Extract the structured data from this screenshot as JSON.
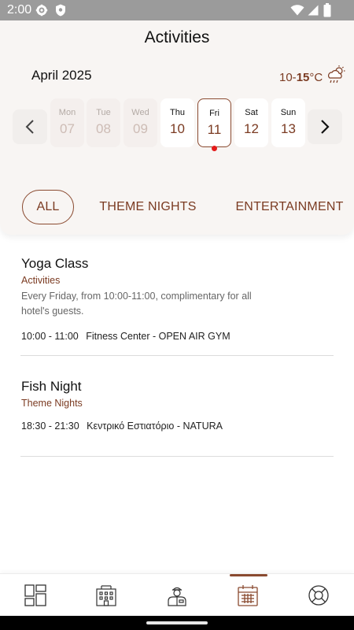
{
  "status_bar": {
    "time": "2:00",
    "icons": [
      "gear-icon",
      "shield-icon",
      "wifi-icon",
      "signal-icon",
      "battery-icon"
    ]
  },
  "header": {
    "title": "Activities"
  },
  "calendar": {
    "month_label": "April 2025",
    "weather": {
      "range_low": "10-",
      "range_high": "15",
      "unit": "°C",
      "icon": "cloud-rain-icon"
    },
    "days": [
      {
        "name": "Mon",
        "date": "07",
        "state": "past"
      },
      {
        "name": "Tue",
        "date": "08",
        "state": "past"
      },
      {
        "name": "Wed",
        "date": "09",
        "state": "past"
      },
      {
        "name": "Thu",
        "date": "10",
        "state": "normal"
      },
      {
        "name": "Fri",
        "date": "11",
        "state": "selected"
      },
      {
        "name": "Sat",
        "date": "12",
        "state": "normal"
      },
      {
        "name": "Sun",
        "date": "13",
        "state": "normal"
      }
    ]
  },
  "filters": [
    {
      "label": "ALL",
      "active": true
    },
    {
      "label": "THEME NIGHTS",
      "active": false
    },
    {
      "label": "ENTERTAINMENT",
      "active": false
    }
  ],
  "events": [
    {
      "title": "Yoga Class",
      "category": "Activities",
      "description": "Every Friday, from 10:00-11:00, complimentary for all hotel's guests.",
      "time": "10:00 - 11:00",
      "location": "Fitness Center - OPEN AIR GYM"
    },
    {
      "title": "Fish Night",
      "category": "Theme Nights",
      "description": "",
      "time": "18:30 - 21:30",
      "location": "Κεντρικό Εστιατόριο - NATURA"
    }
  ],
  "bottom_nav": [
    {
      "icon": "dashboard-icon",
      "active": false
    },
    {
      "icon": "hotel-building-icon",
      "active": false
    },
    {
      "icon": "concierge-icon",
      "active": false
    },
    {
      "icon": "calendar-icon",
      "active": true
    },
    {
      "icon": "lifebuoy-icon",
      "active": false
    }
  ],
  "colors": {
    "accent": "#7b3b22",
    "header_bg": "#f8f5f3",
    "status_bar": "#9b9b9b",
    "event_dot": "#e41b1b"
  }
}
